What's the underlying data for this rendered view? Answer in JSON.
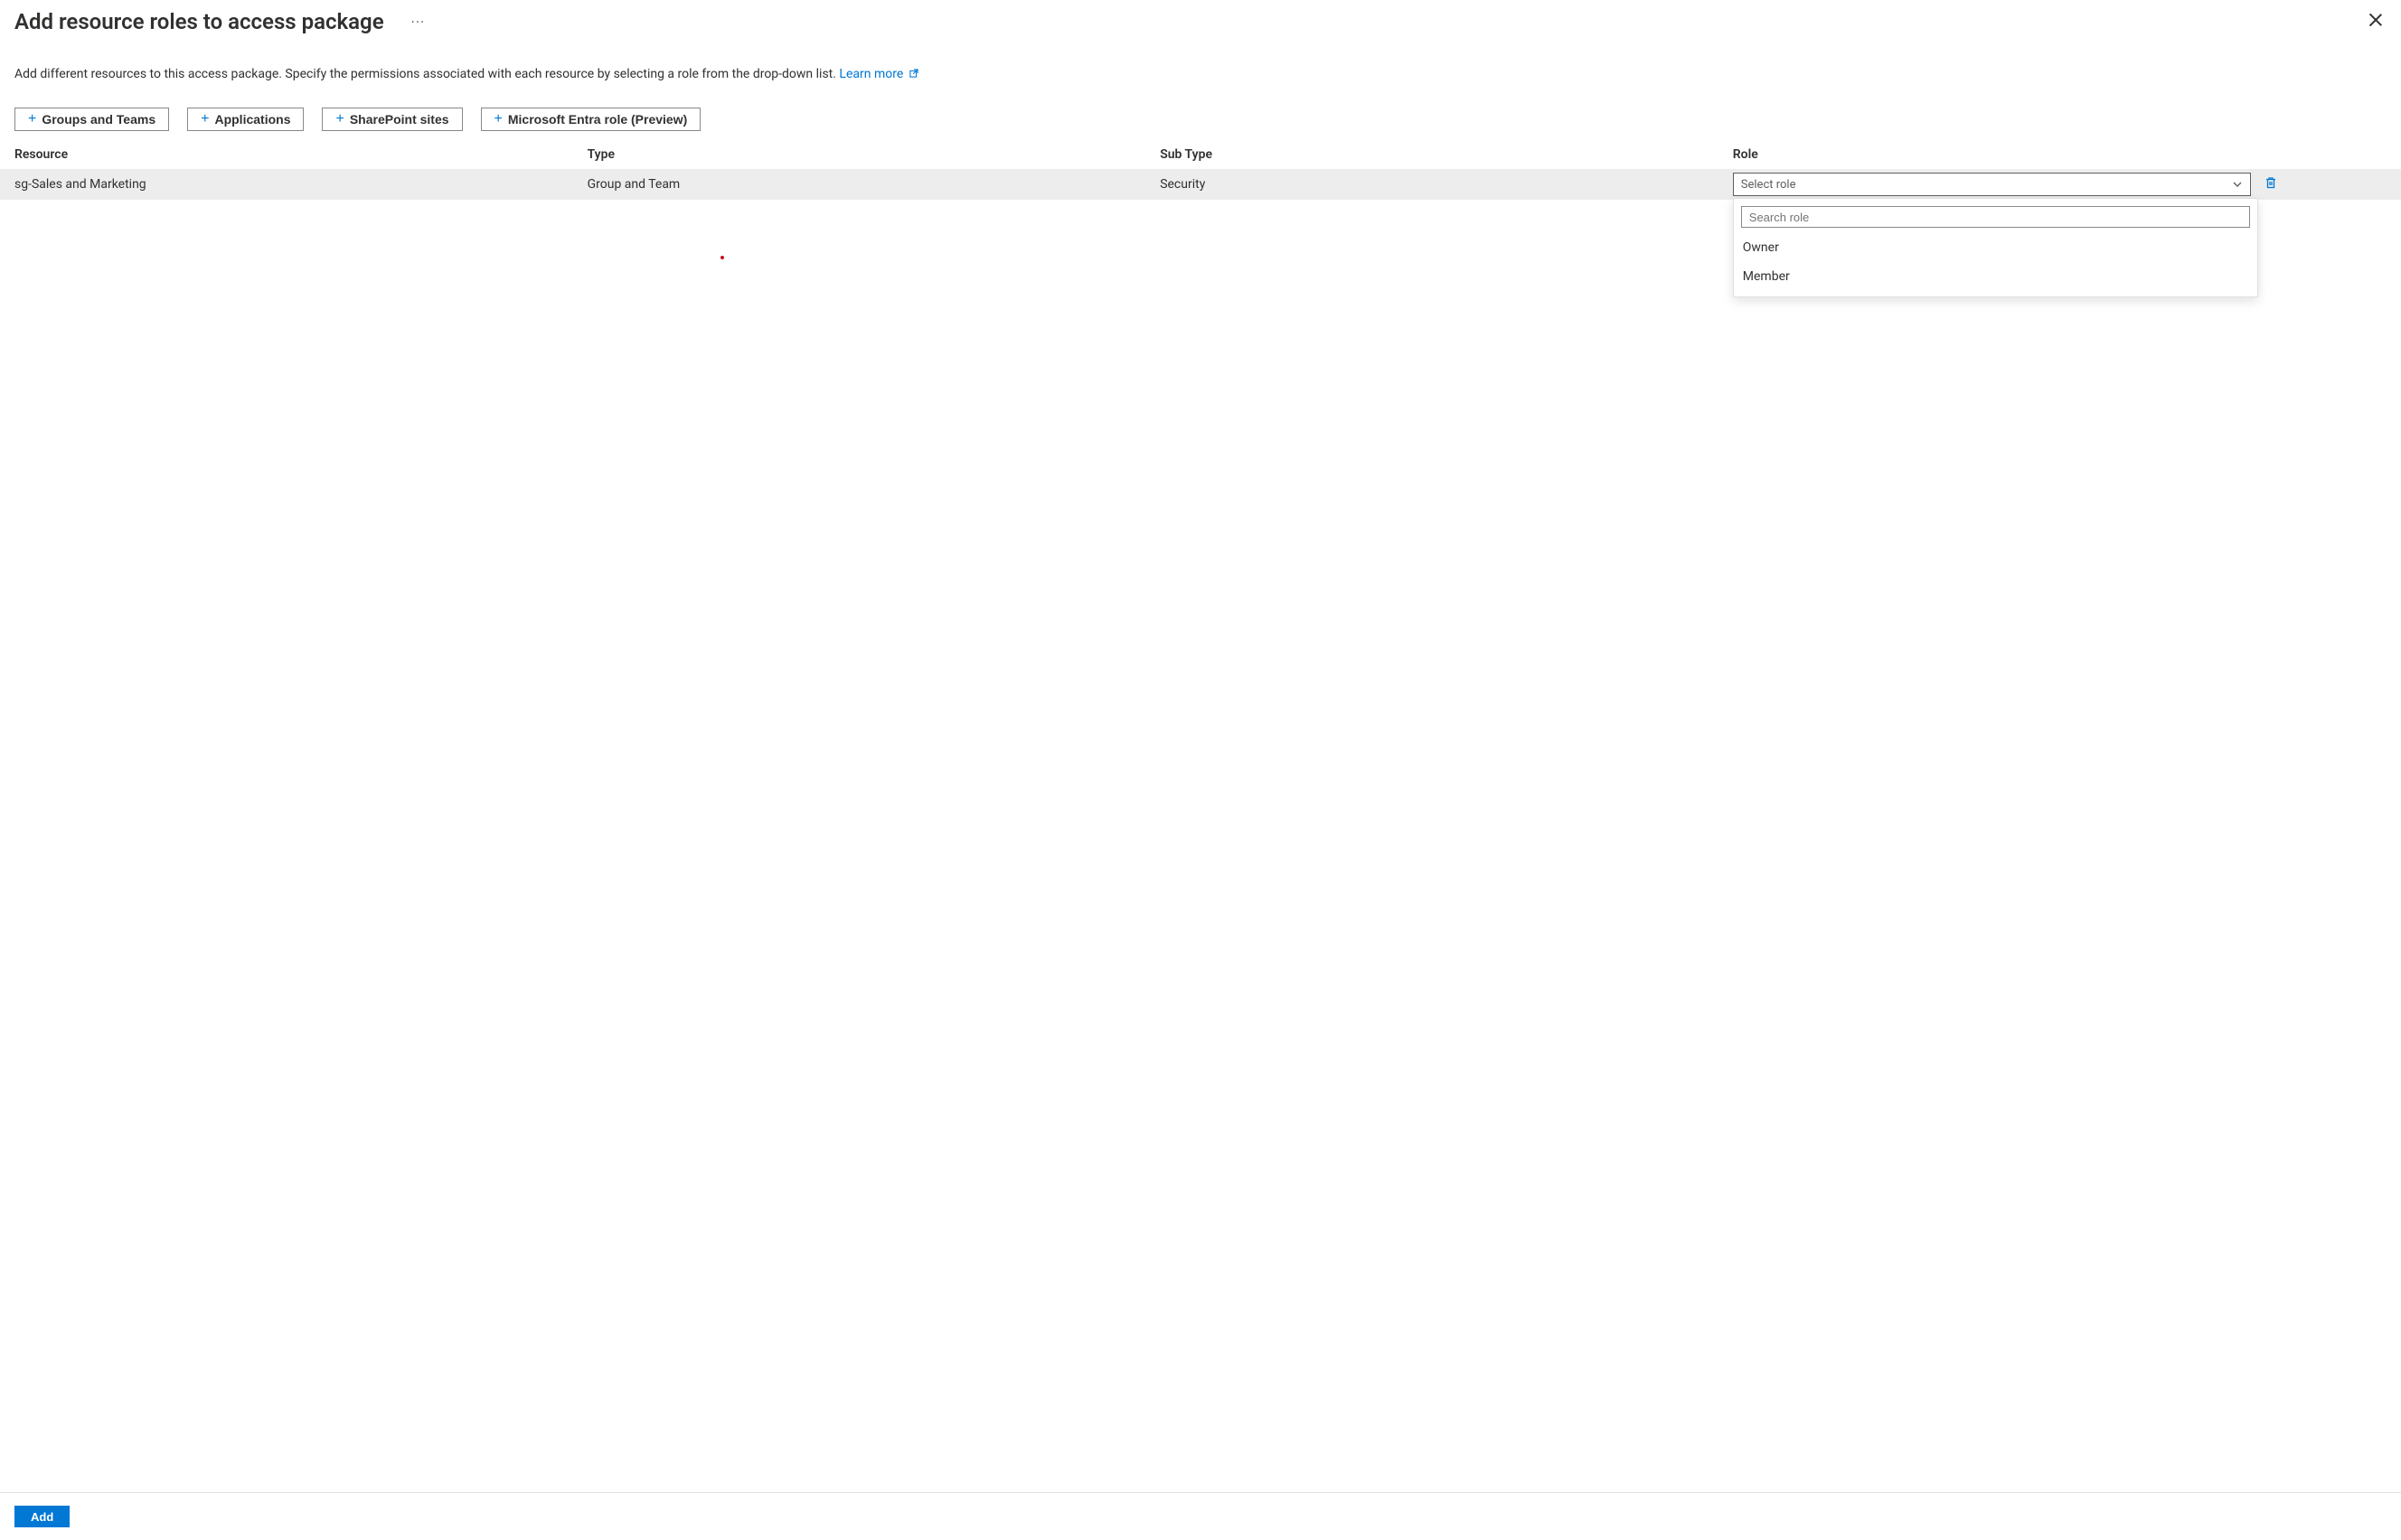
{
  "header": {
    "title": "Add resource roles to access package"
  },
  "description": {
    "text": "Add different resources to this access package. Specify the permissions associated with each resource by selecting a role from the drop-down list. ",
    "learn_more": "Learn more"
  },
  "toolbar": {
    "groups_teams": "Groups and Teams",
    "applications": "Applications",
    "sharepoint": "SharePoint sites",
    "entra_role": "Microsoft Entra role (Preview)"
  },
  "table": {
    "headers": {
      "resource": "Resource",
      "type": "Type",
      "subtype": "Sub Type",
      "role": "Role"
    },
    "rows": [
      {
        "resource": "sg-Sales and Marketing",
        "type": "Group and Team",
        "subtype": "Security"
      }
    ]
  },
  "role_select": {
    "placeholder": "Select role",
    "search_placeholder": "Search role",
    "options": [
      "Owner",
      "Member"
    ]
  },
  "footer": {
    "add": "Add"
  }
}
